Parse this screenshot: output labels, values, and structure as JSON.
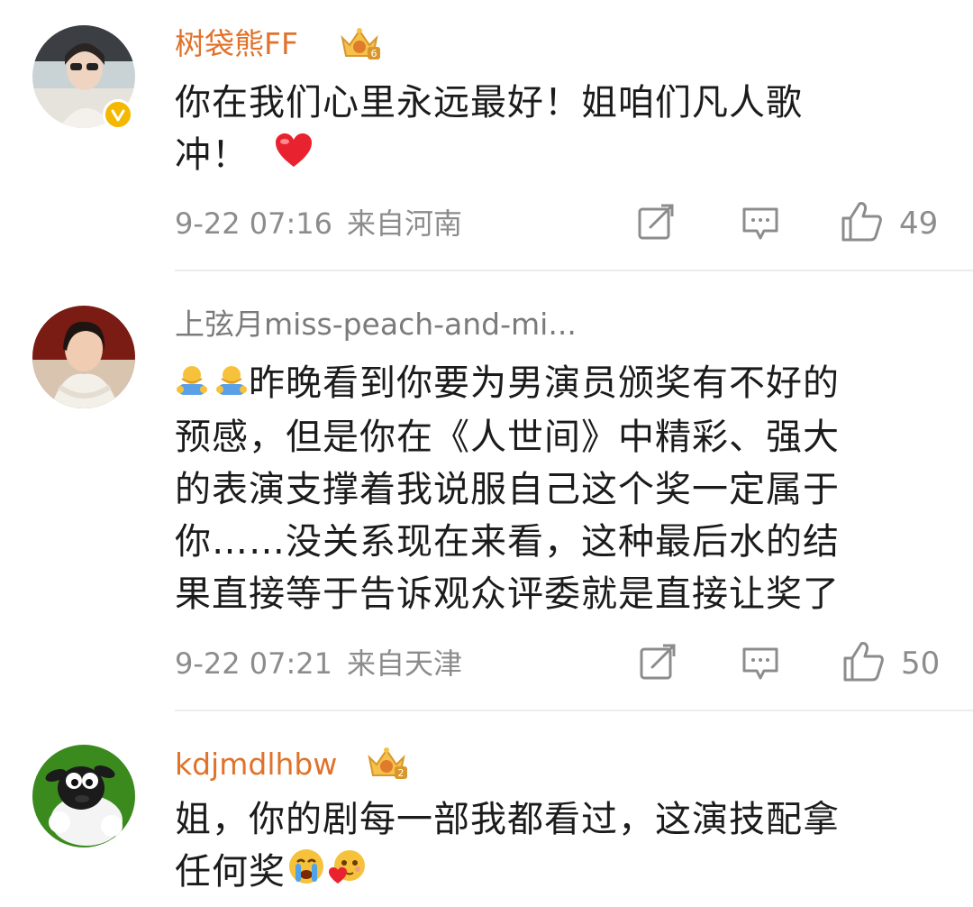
{
  "comments": [
    {
      "username": "树袋熊FF",
      "text_line1": "你在我们心里永远最好！姐咱们凡人歌",
      "text_line2": "冲！",
      "time": "9-22 07:16",
      "location": "来自河南",
      "likes": "49",
      "crown_level": "6",
      "verified": true
    },
    {
      "username": "上弦月miss-peach-and-mi...",
      "text_lines": [
        "昨晚看到你要为男演员颁奖有不好的",
        "预感，但是你在《人世间》中精彩、强大",
        "的表演支撑着我说服自己这个奖一定属于",
        "你……没关系现在来看，这种最后水的结",
        "果直接等于告诉观众评委就是直接让奖了"
      ],
      "time": "9-22 07:21",
      "location": "来自天津",
      "likes": "50"
    },
    {
      "username": "kdjmdlhbw",
      "text_line1": "姐，你的剧每一部我都看过，这演技配拿",
      "text_line2": "任何奖",
      "crown_level": "2"
    }
  ],
  "icons": {
    "repost": "repost-icon",
    "comment": "comment-icon",
    "like": "thumbs-up-icon",
    "heart": "red-heart-emoji",
    "hug": "hug-emoji",
    "cry": "crying-emoji",
    "love": "love-face-emoji"
  },
  "colors": {
    "vip_name": "#e0722a",
    "normal_name": "#7b7b7b",
    "meta": "#8c8c8c",
    "text": "#1b1b1b",
    "heart": "#e8232f"
  }
}
